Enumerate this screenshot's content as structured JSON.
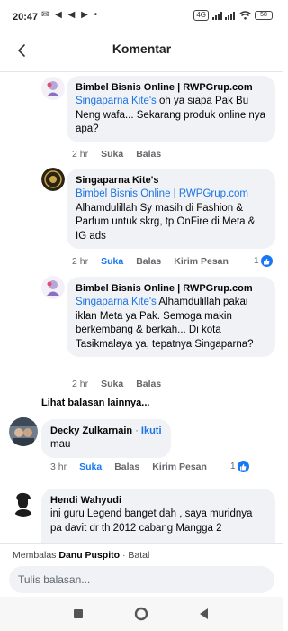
{
  "status_bar": {
    "time": "20:47",
    "left_icons": "✉ ◀ ◀ ▶ •",
    "signal_text": "4G",
    "battery": "58"
  },
  "header": {
    "title": "Komentar"
  },
  "comments": [
    {
      "name": "Bimbel Bisnis Online | RWPGrup.com",
      "mention": "Singaparna Kite's",
      "text": " oh ya siapa Pak Bu Neng wafa... Sekarang produk online nya apa?",
      "time": "2 hr",
      "like": "Suka",
      "reply": "Balas"
    },
    {
      "name": "Singaparna Kite's",
      "mention": "Bimbel Bisnis Online | RWPGrup.com",
      "text": " Alhamdulillah Sy masih di Fashion & Parfum untuk skrg, tp OnFire di Meta & IG ads",
      "time": "2 hr",
      "like": "Suka",
      "reply": "Balas",
      "send": "Kirim Pesan",
      "reactions": "1"
    },
    {
      "name": "Bimbel Bisnis Online | RWPGrup.com",
      "mention": "Singaparna Kite's",
      "text": " Alhamdulillah pakai iklan Meta ya Pak. Semoga makin berkembang & berkah... Di kota Tasikmalaya ya, tepatnya Singaparna?",
      "time": "2 hr",
      "like": "Suka",
      "reply": "Balas"
    }
  ],
  "more_replies": "Lihat balasan lainnya...",
  "comment_decky": {
    "name": "Decky Zulkarnain",
    "follow": "Ikuti",
    "text": "mau",
    "time": "3 hr",
    "like": "Suka",
    "reply": "Balas",
    "send": "Kirim Pesan",
    "reactions": "1"
  },
  "comment_hendi": {
    "name": "Hendi Wahyudi",
    "text": "ini guru Legend banget dah , saya muridnya pa davit dr th 2012 cabang Mangga 2"
  },
  "reply_bar": {
    "prefix": "Membalas",
    "target": "Danu Puspito",
    "cancel": "Batal",
    "placeholder": "Tulis balasan..."
  },
  "colors": {
    "link": "#1b74e4",
    "like_blue": "#1877f2",
    "bubble": "#f0f2f5"
  }
}
